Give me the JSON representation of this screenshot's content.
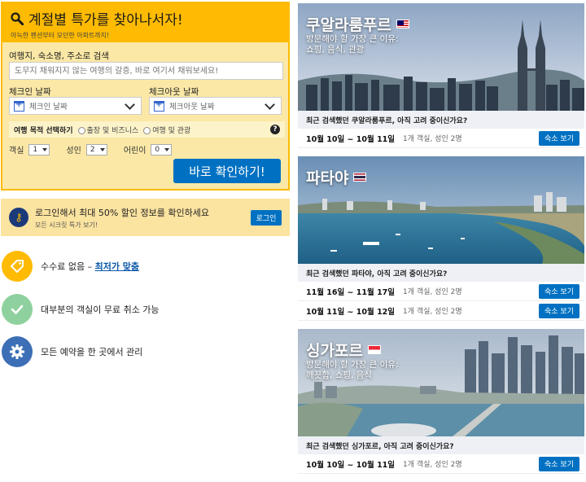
{
  "search": {
    "title": "계절별 특가를 찾아나서자!",
    "subtitle": "아늑한 펜션부터 모던한 아파트까지!",
    "destination_label": "여행지, 숙소명, 주소로 검색",
    "destination_placeholder": "도무지 채워지지 않는 여행의 갈증, 바로 여기서 채워보세요!",
    "checkin_label": "체크인 날짜",
    "checkin_placeholder": "체크인 날짜",
    "checkout_label": "체크아웃 날짜",
    "checkout_placeholder": "체크아웃 날짜",
    "purpose_label": "여행 목적 선택하기",
    "purpose_options": [
      "출장 및 비즈니스",
      "여행 및 관광"
    ],
    "rooms_label": "객실",
    "rooms_value": "1",
    "adults_label": "성인",
    "adults_value": "2",
    "children_label": "어린이",
    "children_value": "0",
    "submit_label": "바로 확인하기!"
  },
  "login_banner": {
    "main": "로그인해서 최대 50% 할인 정보를 확인하세요",
    "sub": "모든 시크릿 특가 보기!",
    "button": "로그인"
  },
  "features": [
    {
      "text": "수수료 없음 – ",
      "link": "최저가 맞춤",
      "icon": "price-tag-icon",
      "color": "#febb02"
    },
    {
      "text": "대부분의 객실이 무료 취소 가능",
      "icon": "checkmark-icon",
      "color": "#8fd19e"
    },
    {
      "text": "모든 예약을 한 곳에서 관리",
      "icon": "gear-icon",
      "color": "#3d6fb6"
    }
  ],
  "cards": [
    {
      "city": "쿠알라룸푸르",
      "subtitle_1": "방문해야 할 가장 큰 이유:",
      "subtitle_2": "쇼핑, 음식, 관광",
      "recent": "최근 검색했던 쿠알라룸푸르, 아직 고려 중이신가요?",
      "trips": [
        {
          "dates": "10월 10일 ~ 10월 11일",
          "info": "1개 객실, 성인 2명",
          "button": "숙소 보기"
        }
      ]
    },
    {
      "city": "파타야",
      "subtitle_1": "",
      "subtitle_2": "",
      "recent": "최근 검색했던 파타야, 아직 고려 중이신가요?",
      "trips": [
        {
          "dates": "11월 16일 ~ 11월 17일",
          "info": "1개 객실, 성인 2명",
          "button": "숙소 보기"
        },
        {
          "dates": "10월 11일 ~ 10월 12일",
          "info": "1개 객실, 성인 2명",
          "button": "숙소 보기"
        }
      ]
    },
    {
      "city": "싱가포르",
      "subtitle_1": "방문해야 할 가장 큰 이유:",
      "subtitle_2": "깨끗함, 쇼핑, 음식",
      "recent": "최근 검색했던 싱가포르, 아직 고려 중이신가요?",
      "trips": [
        {
          "dates": "10월 10일 ~ 10월 11일",
          "info": "1개 객실, 성인 2명",
          "button": "숙소 보기"
        }
      ]
    }
  ]
}
